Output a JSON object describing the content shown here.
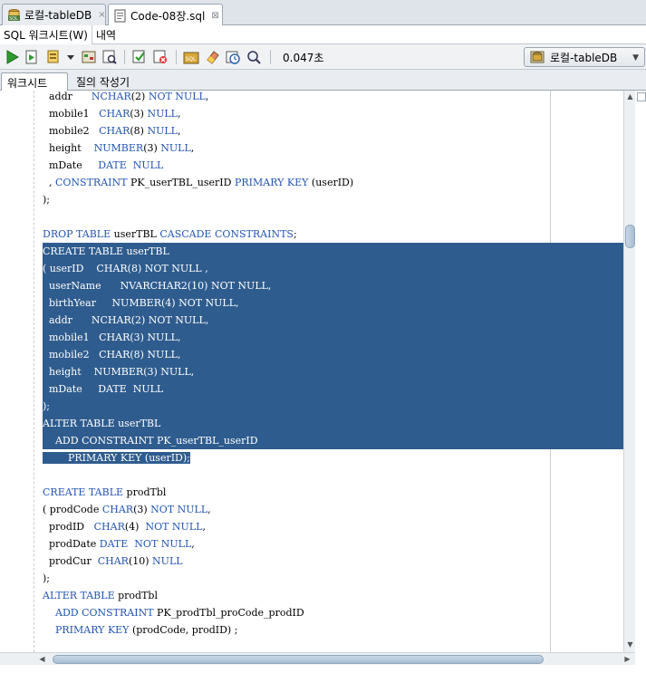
{
  "file_tabs": [
    {
      "label": "로컬-tableDB",
      "icon": "sql-connection-icon",
      "close": "×"
    },
    {
      "label": "Code-08장.sql",
      "icon": "sql-file-icon",
      "close": "⊠"
    }
  ],
  "sub_tabs": [
    "SQL 워크시트(W)",
    "내역"
  ],
  "toolbar": {
    "elapsed": "0.047초",
    "connection": "로컬-tableDB",
    "icons": [
      "run-statement-icon",
      "run-script-icon",
      "commit-icon",
      "dropdown-icon",
      "explain-plan-icon",
      "autotrace-icon",
      "commit-icon",
      "rollback-icon",
      "sql-tuning-icon",
      "eraser-icon",
      "history-icon",
      "find-icon"
    ]
  },
  "worksheet_tabs": [
    "워크시트",
    "질의 작성기"
  ],
  "code_lines": [
    [
      {
        "t": "  addr      "
      },
      {
        "t": "NCHAR",
        "k": 1
      },
      {
        "t": "(2) "
      },
      {
        "t": "NOT NULL",
        "k": 1
      },
      {
        "t": ","
      }
    ],
    [
      {
        "t": "  mobile1   "
      },
      {
        "t": "CHAR",
        "k": 1
      },
      {
        "t": "(3) "
      },
      {
        "t": "NULL",
        "k": 1
      },
      {
        "t": ","
      }
    ],
    [
      {
        "t": "  mobile2   "
      },
      {
        "t": "CHAR",
        "k": 1
      },
      {
        "t": "(8) "
      },
      {
        "t": "NULL",
        "k": 1
      },
      {
        "t": ","
      }
    ],
    [
      {
        "t": "  height    "
      },
      {
        "t": "NUMBER",
        "k": 1
      },
      {
        "t": "(3) "
      },
      {
        "t": "NULL",
        "k": 1
      },
      {
        "t": ","
      }
    ],
    [
      {
        "t": "  mDate     "
      },
      {
        "t": "DATE",
        "k": 1
      },
      {
        "t": "  "
      },
      {
        "t": "NULL",
        "k": 1
      }
    ],
    [
      {
        "t": "  , "
      },
      {
        "t": "CONSTRAINT",
        "k": 1
      },
      {
        "t": " PK_userTBL_userID "
      },
      {
        "t": "PRIMARY KEY",
        "k": 1
      },
      {
        "t": " (userID)"
      }
    ],
    [
      {
        "t": ");"
      }
    ],
    [
      {
        "t": ""
      }
    ],
    [
      {
        "t": "DROP TABLE",
        "k": 1
      },
      {
        "t": " userTBL "
      },
      {
        "t": "CASCADE CONSTRAINTS",
        "k": 1
      },
      {
        "t": ";"
      }
    ],
    [
      {
        "t": "CREATE TABLE userTBL"
      }
    ],
    [
      {
        "t": "( userID    CHAR(8) NOT NULL ,"
      }
    ],
    [
      {
        "t": "  userName      NVARCHAR2(10) NOT NULL,"
      }
    ],
    [
      {
        "t": "  birthYear     NUMBER(4) NOT NULL,"
      }
    ],
    [
      {
        "t": "  addr      NCHAR(2) NOT NULL,"
      }
    ],
    [
      {
        "t": "  mobile1   CHAR(3) NULL,"
      }
    ],
    [
      {
        "t": "  mobile2   CHAR(8) NULL,"
      }
    ],
    [
      {
        "t": "  height    NUMBER(3) NULL,"
      }
    ],
    [
      {
        "t": "  mDate     DATE  NULL"
      }
    ],
    [
      {
        "t": ");"
      }
    ],
    [
      {
        "t": "ALTER TABLE userTBL"
      }
    ],
    [
      {
        "t": "    ADD CONSTRAINT PK_userTBL_userID"
      }
    ],
    [
      {
        "t": "        PRIMARY KEY (userID);"
      }
    ],
    [
      {
        "t": ""
      }
    ],
    [
      {
        "t": "CREATE TABLE",
        "k": 1
      },
      {
        "t": " prodTbl"
      }
    ],
    [
      {
        "t": "( prodCode "
      },
      {
        "t": "CHAR",
        "k": 1
      },
      {
        "t": "(3) "
      },
      {
        "t": "NOT NULL",
        "k": 1
      },
      {
        "t": ","
      }
    ],
    [
      {
        "t": "  prodID   "
      },
      {
        "t": "CHAR",
        "k": 1
      },
      {
        "t": "(4)  "
      },
      {
        "t": "NOT NULL",
        "k": 1
      },
      {
        "t": ","
      }
    ],
    [
      {
        "t": "  prodDate "
      },
      {
        "t": "DATE",
        "k": 1
      },
      {
        "t": "  "
      },
      {
        "t": "NOT NULL",
        "k": 1
      },
      {
        "t": ","
      }
    ],
    [
      {
        "t": "  prodCur  "
      },
      {
        "t": "CHAR",
        "k": 1
      },
      {
        "t": "(10) "
      },
      {
        "t": "NULL",
        "k": 1
      }
    ],
    [
      {
        "t": ");"
      }
    ],
    [
      {
        "t": "ALTER TABLE",
        "k": 1
      },
      {
        "t": " prodTbl"
      }
    ],
    [
      {
        "t": "    "
      },
      {
        "t": "ADD CONSTRAINT",
        "k": 1
      },
      {
        "t": " PK_prodTbl_proCode_prodID"
      }
    ],
    [
      {
        "t": "    "
      },
      {
        "t": "PRIMARY KEY",
        "k": 1
      },
      {
        "t": " (prodCode, prodID) ;"
      }
    ]
  ],
  "selection": {
    "full_lines": [
      9,
      10,
      11,
      12,
      13,
      14,
      15,
      16,
      17,
      18,
      19,
      20
    ],
    "partial_line": 21
  },
  "colors": {
    "keyword": "#2355b2",
    "selection": "#2f5c8e"
  }
}
